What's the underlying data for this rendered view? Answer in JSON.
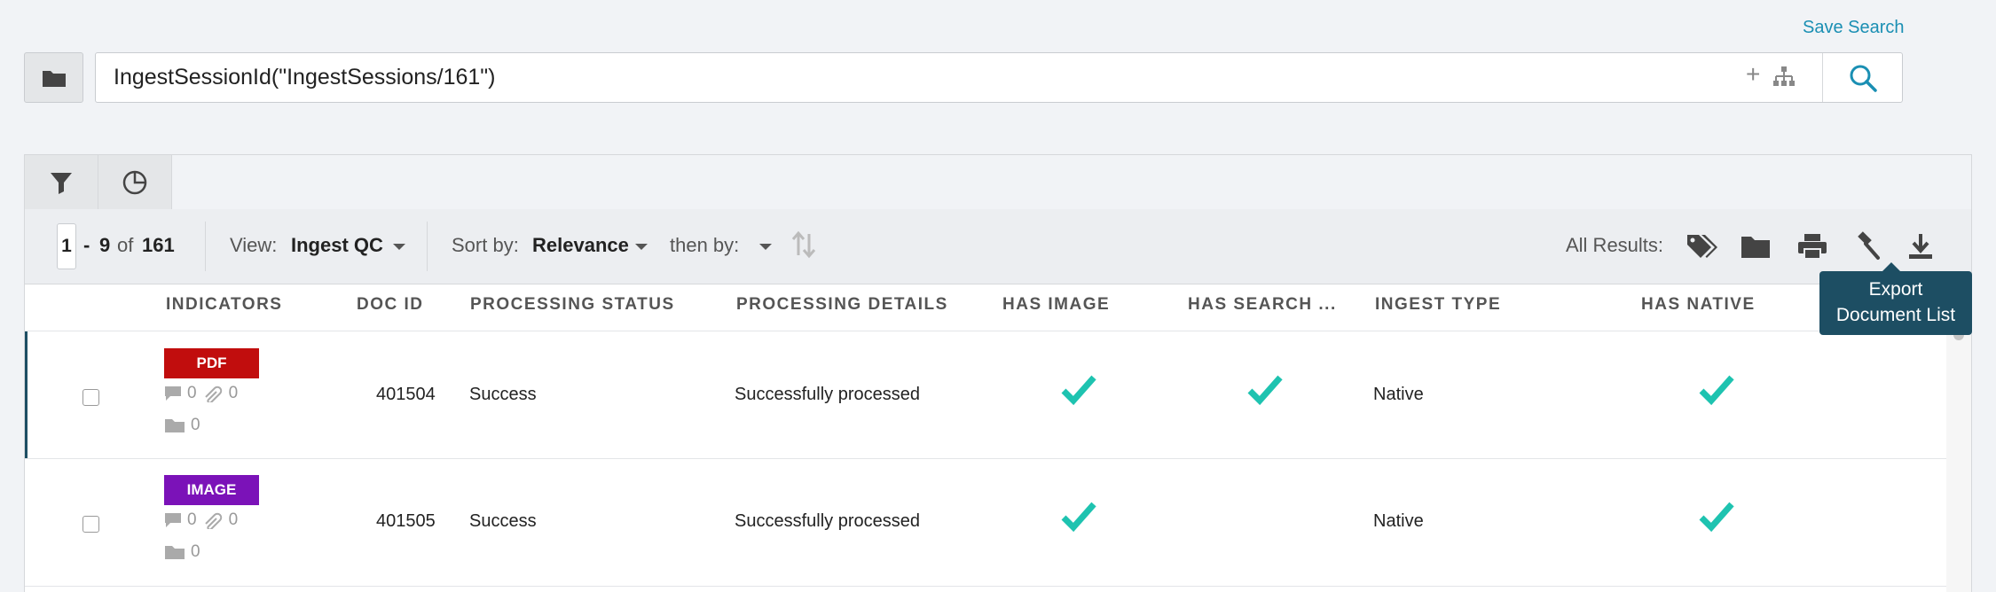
{
  "header": {
    "save_search": "Save Search",
    "search_query": "IngestSessionId(\"IngestSessions/161\")",
    "plus": "+"
  },
  "toolbar": {
    "page_start": "1",
    "range_sep": "-",
    "page_end": "9",
    "of_label": "of",
    "total": "161",
    "view_label": "View:",
    "view_value": "Ingest QC",
    "sort_label": "Sort by:",
    "sort_value": "Relevance",
    "then_by_label": "then by:",
    "all_results_label": "All Results:"
  },
  "tooltip": {
    "line1": "Export",
    "line2": "Document List"
  },
  "columns": {
    "indicators": "INDICATORS",
    "doc_id": "DOC ID",
    "processing_status": "PROCESSING STATUS",
    "processing_details": "PROCESSING DETAILS",
    "has_image": "HAS IMAGE",
    "has_search": "HAS SEARCH ...",
    "ingest_type": "INGEST TYPE",
    "has_native": "HAS NATIVE"
  },
  "rows": [
    {
      "badge": "PDF",
      "badge_color": "#c10d0d",
      "comments": "0",
      "attachments": "0",
      "folders": "0",
      "doc_id": "401504",
      "status": "Success",
      "details": "Successfully processed",
      "has_image": true,
      "has_search": true,
      "ingest_type": "Native",
      "has_native": true
    },
    {
      "badge": "IMAGE",
      "badge_color": "#7b12b8",
      "comments": "0",
      "attachments": "0",
      "folders": "0",
      "doc_id": "401505",
      "status": "Success",
      "details": "Successfully processed",
      "has_image": true,
      "has_search": false,
      "ingest_type": "Native",
      "has_native": true
    }
  ],
  "colors": {
    "accent_teal": "#1ec3b0",
    "link_blue": "#1a8fb3",
    "tooltip_bg": "#1d4e63"
  },
  "icons": [
    "folder-icon",
    "hierarchy-icon",
    "search-icon",
    "filter-icon",
    "pie-chart-icon",
    "sort-icon",
    "tag-icon",
    "print-icon",
    "gavel-icon",
    "download-icon",
    "comment-icon",
    "paperclip-icon",
    "checkmark-icon"
  ]
}
